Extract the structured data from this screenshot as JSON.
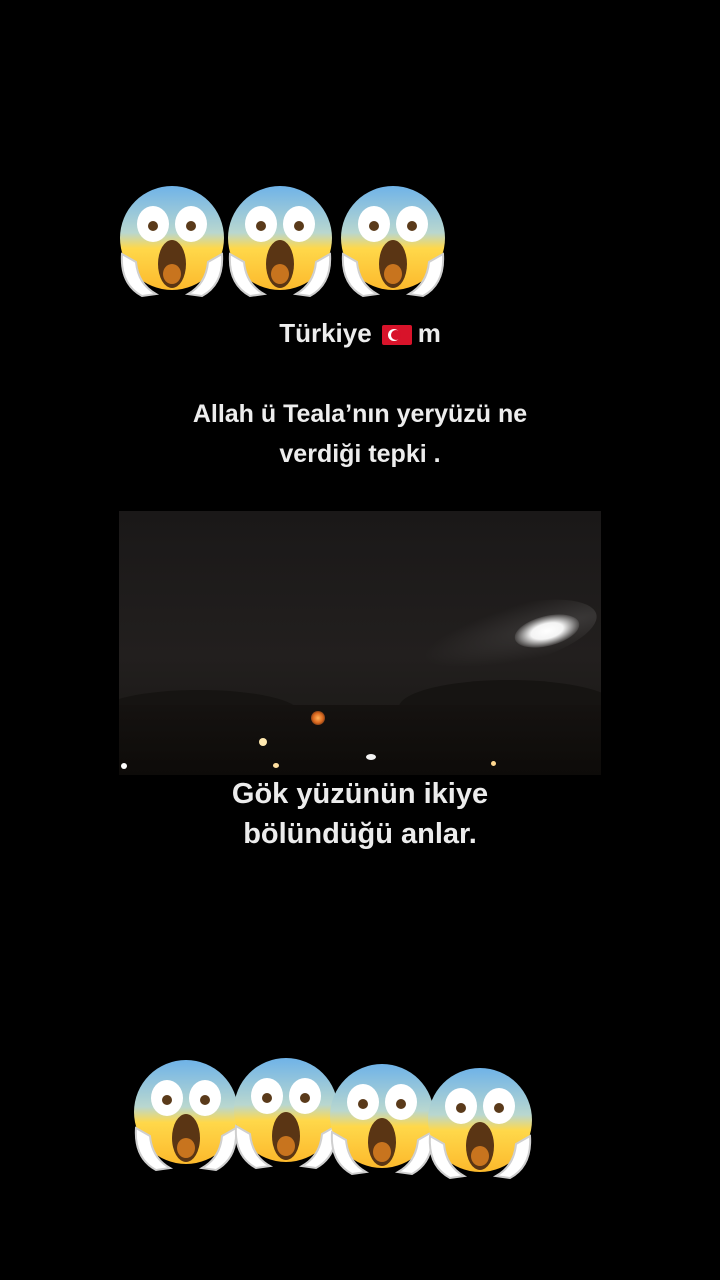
{
  "top_caption": {
    "line1_text": "Türkiye",
    "line1_suffix": "m",
    "flag_icon": "turkey-flag-icon",
    "line2": "Allah ü Teala’nın yeryüzü ne",
    "line3": "verdiği  tepki ."
  },
  "bottom_caption": {
    "line1": "Gök yüzünün ikiye",
    "line2": "bölündüğü  anlar."
  },
  "emojis": {
    "top_row_icon": "face-screaming-in-fear-icon",
    "top_row_count": 3,
    "bottom_row_icon": "face-screaming-in-fear-icon",
    "bottom_row_count": 4
  },
  "colors": {
    "background": "#000000",
    "text": "#ececec",
    "flag_red": "#d8132a"
  }
}
